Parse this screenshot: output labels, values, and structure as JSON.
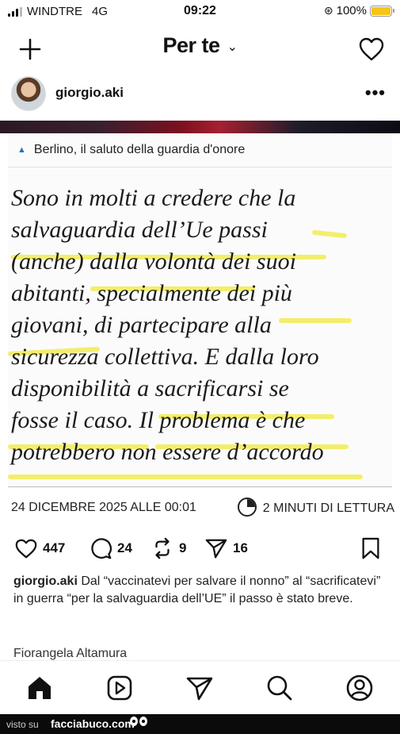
{
  "status_bar": {
    "carrier": "WINDTRE",
    "network": "4G",
    "time": "09:22",
    "battery": "100%",
    "battery_level": 1.0,
    "battery_color": "#f5c518"
  },
  "header": {
    "title": "Per te",
    "chevron": "⌄",
    "icons": [
      "plus-icon",
      "heart-icon"
    ]
  },
  "author": {
    "username": "giorgio.aki",
    "more": "•••"
  },
  "post_image": {
    "caption": "Berlino, il saluto della guardia d'onore",
    "quote_lines": [
      "Sono in molti a credere che la",
      "salvaguardia dell’Ue passi",
      "(anche) dalla volontà dei suoi",
      "abitanti, specialmente dei più",
      "giovani, di partecipare alla",
      "sicurezza collettiva. E dalla loro",
      "disponibilità a sacrificarsi se",
      "fosse il caso. Il problema è che",
      "potrebbero non essere d’accordo"
    ],
    "highlight_color": "#f2ec5c",
    "date": "24 DICEMBRE 2025 ALLE 00:01",
    "read_time": "2 MINUTI DI LETTURA"
  },
  "actions": {
    "likes": "447",
    "comments": "24",
    "reposts": "9",
    "shares": "16"
  },
  "post_caption": {
    "username": "giorgio.aki",
    "text": " Dal “vaccinatevi per salvare il nonno” al “sacrificatevi” in guerra “per la salvaguardia dell’UE” il passo è stato breve."
  },
  "next_comment_user": "Fiorangela Altamura",
  "tabbar": {
    "tabs": [
      "home-icon",
      "reels-icon",
      "send-icon",
      "search-icon",
      "profile-icon"
    ]
  },
  "watermark": {
    "prefix": "visto su",
    "brand": "facciabuco.com"
  }
}
